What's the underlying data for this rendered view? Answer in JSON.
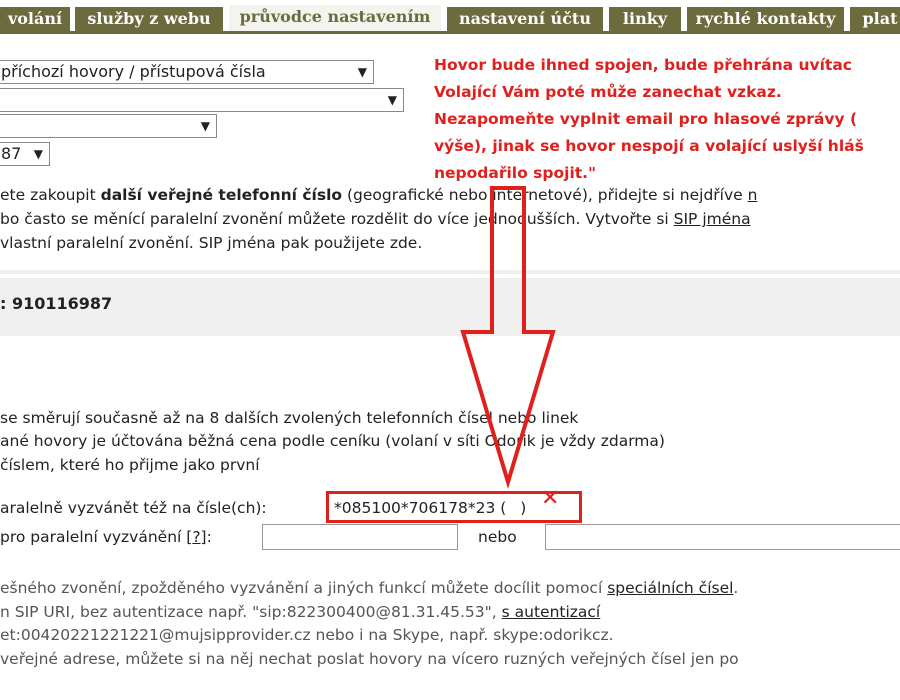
{
  "tabs": [
    {
      "label": "volání",
      "active": false
    },
    {
      "label": "služby z webu",
      "active": false
    },
    {
      "label": "průvodce nastavením",
      "active": true
    },
    {
      "label": "nastavení účtu",
      "active": false
    },
    {
      "label": "linky",
      "active": false
    },
    {
      "label": "rychlé kontakty",
      "active": false
    },
    {
      "label": "plat",
      "active": false
    }
  ],
  "selects": {
    "s1": "příchozí hovory / přístupová čísla",
    "s2": "",
    "s3": "",
    "s4": "87"
  },
  "note": {
    "lines": [
      "Hovor bude ihned spojen, bude přehrána uvítac",
      "Volající Vám poté může zanechat vzkaz.",
      "Nezapomeňte vyplnit email pro hlasové zprávy (",
      "výše), jinak se hovor nespojí a volající uslyší hláš",
      "nepodařilo spojit.\""
    ],
    "color": "#e0201c"
  },
  "intro": {
    "line1_pre": "ete zakoupit ",
    "line1_bold": "další veřejné telefonní číslo",
    "line1_post": " (geografické nebo internetové), přidejte si nejdříve ",
    "line1_link": "n",
    "line2_pre": "bo často se měnící paralelní zvonění můžete rozdělit do více jednodušších. Vytvořte si ",
    "line2_link": "SIP jména",
    "line3": "vlastní paralelní zvonění. SIP jména pak použijete zde."
  },
  "number_label": ": 910116987",
  "info": {
    "line1": "se směrují současně až na 8 dalších zvolených telefonních čísel nebo linek",
    "line2": "ané hovory je účtována běžná cena podle ceníku (volaní v síti Odorik je vždy zdarma)",
    "line3": "číslem, které ho přijme jako první"
  },
  "parallel": {
    "label": "aralelně vyzvánět též na čísle(ch):",
    "value": "*085100*706178*23 (",
    "value_end": ")"
  },
  "sip_row": {
    "label": "pro paralelní vyzvánění [",
    "help": "?",
    "label_end": "]:",
    "or": "nebo"
  },
  "footer": {
    "line1_pre": "ešného zvonění, zpožděného vyzvánění a jiných funkcí můžete docílit pomocí ",
    "line1_link": "speciálních čísel",
    "line1_post": ".",
    "line2_pre": "n SIP URI, bez autentizace např. \"sip:822300400@81.31.45.53\", ",
    "line2_link": "s autentizací",
    "line3": "et:00420221221221@mujsipprovider.cz nebo i na Skype, např. skype:odorikcz.",
    "line4": "veřejné adrese, můžete si na něj nechat poslat hovory na vícero ruzných veřejných čísel jen po"
  },
  "colors": {
    "tab": "#6b6b3e",
    "annotation": "#e0201c"
  }
}
